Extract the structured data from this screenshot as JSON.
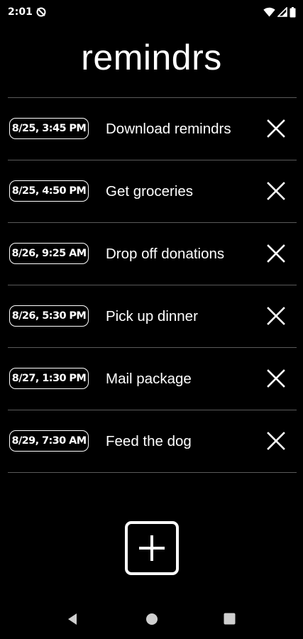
{
  "status_bar": {
    "time": "2:01",
    "icons": [
      "sync-off-icon",
      "wifi-icon",
      "cell-signal-icon",
      "battery-icon"
    ]
  },
  "app": {
    "title": "remindrs"
  },
  "reminders": [
    {
      "time": "8/25, 3:45 PM",
      "text": "Download remindrs"
    },
    {
      "time": "8/25, 4:50 PM",
      "text": "Get groceries"
    },
    {
      "time": "8/26, 9:25 AM",
      "text": "Drop off donations"
    },
    {
      "time": "8/26, 5:30 PM",
      "text": "Pick up dinner"
    },
    {
      "time": "8/27, 1:30 PM",
      "text": "Mail package"
    },
    {
      "time": "8/29, 7:30 AM",
      "text": "Feed the dog"
    }
  ],
  "actions": {
    "add_icon": "plus-icon",
    "delete_icon": "close-icon"
  },
  "nav_bar": {
    "icons": [
      "back-icon",
      "home-icon",
      "recents-icon"
    ]
  },
  "colors": {
    "background": "#000000",
    "foreground": "#ffffff",
    "divider": "#5a5a5a"
  }
}
